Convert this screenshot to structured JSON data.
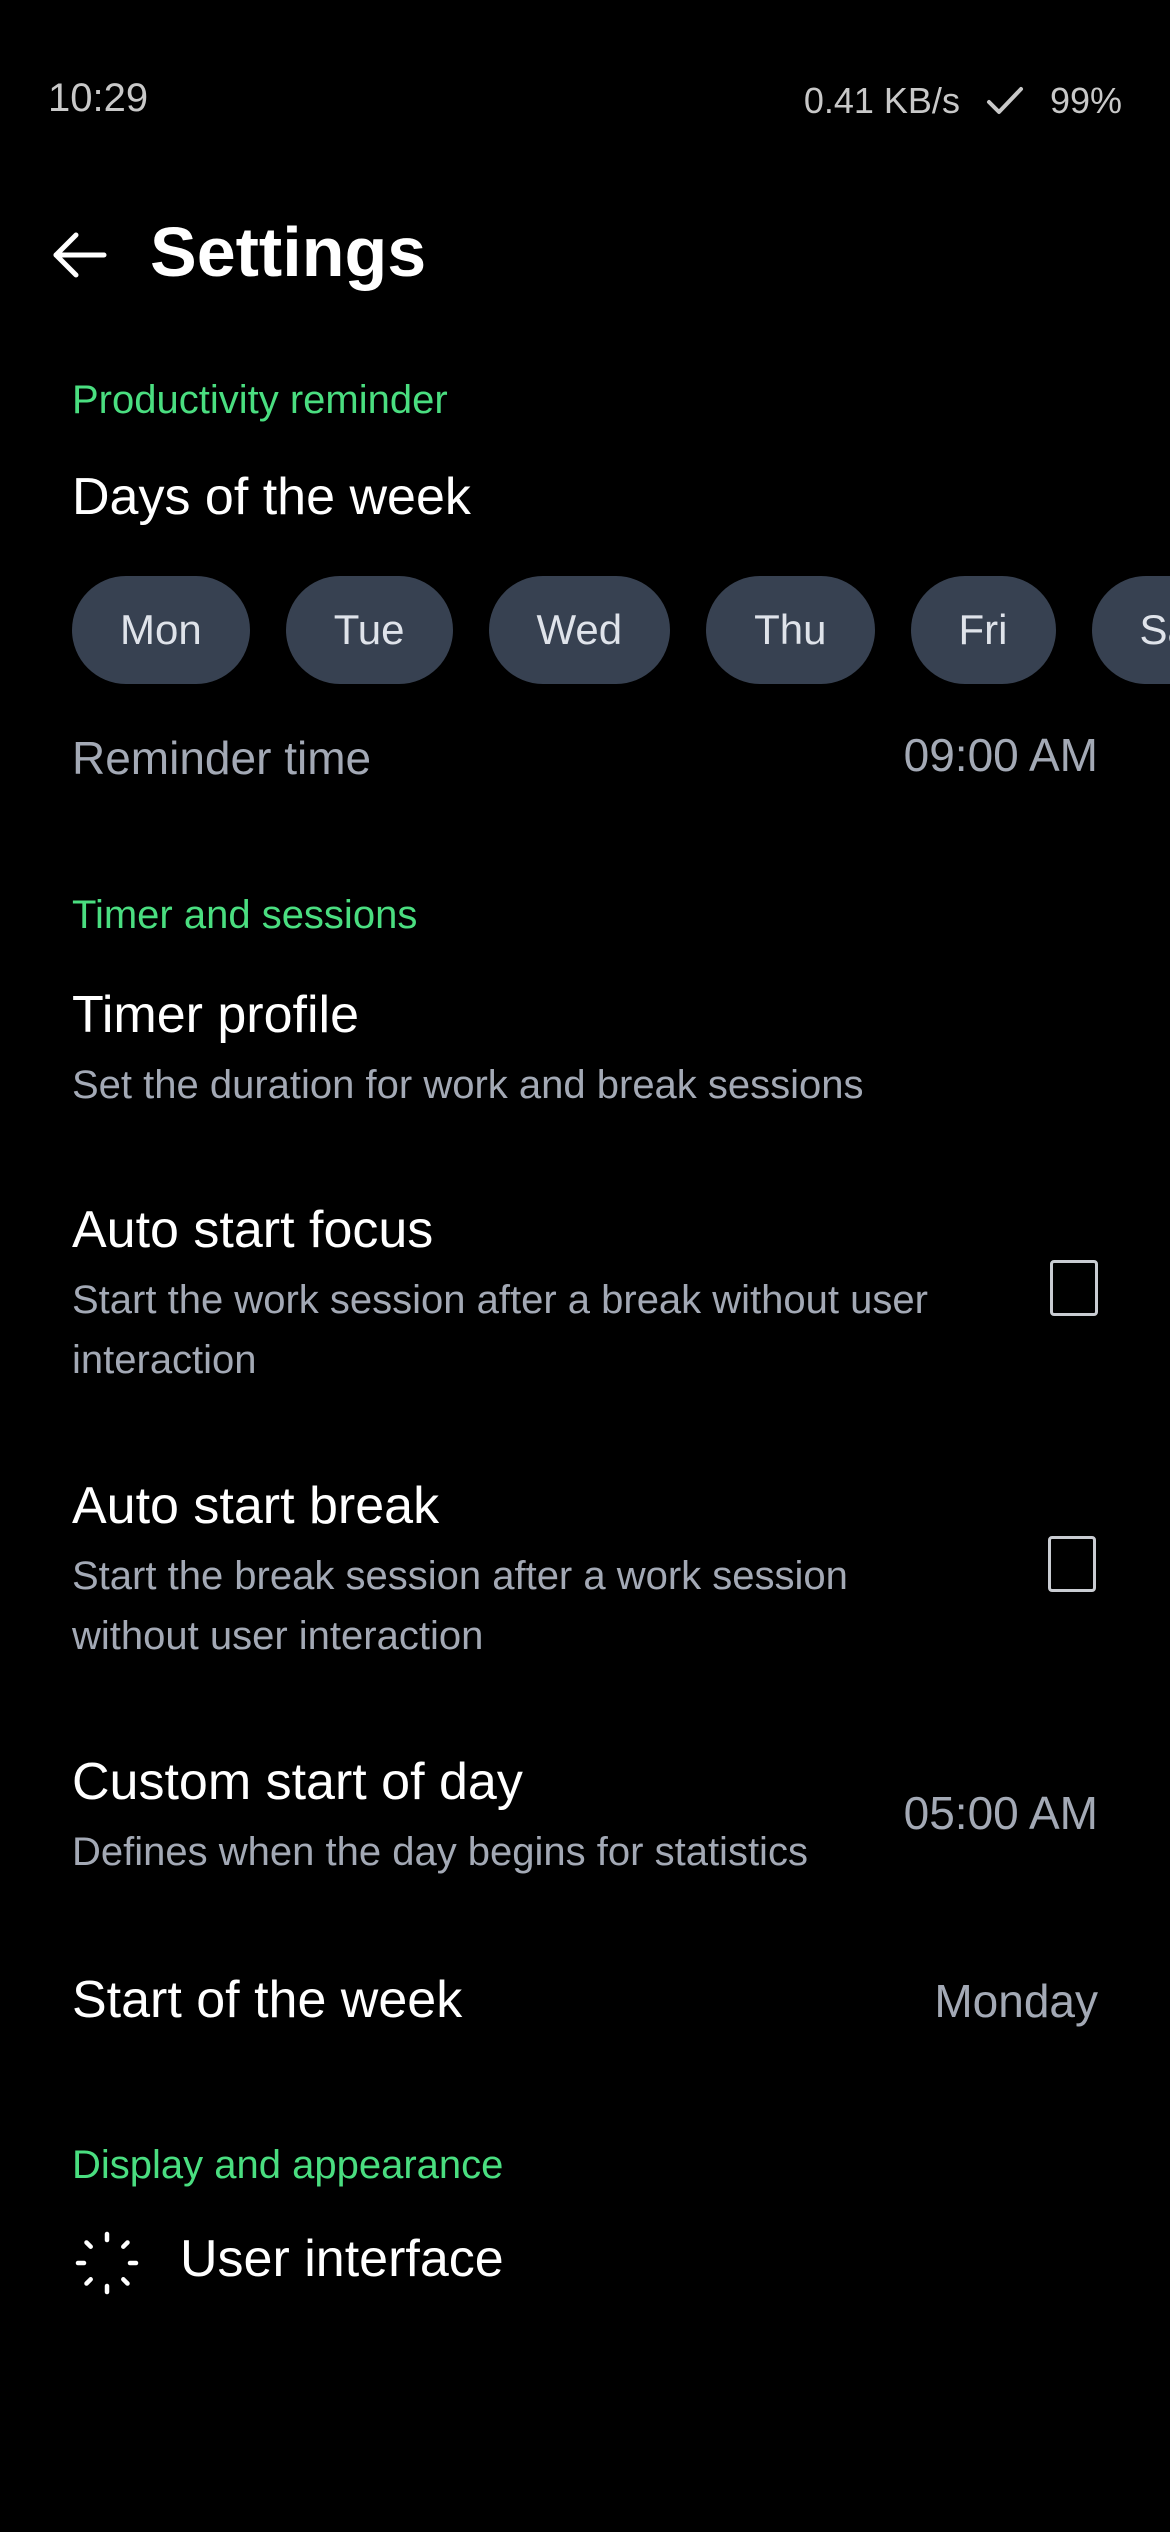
{
  "status_bar": {
    "time": "10:29",
    "network_speed": "0.41 KB/s",
    "battery": "99%",
    "icons": [
      "check-icon"
    ]
  },
  "app_bar": {
    "title": "Settings",
    "back_icon": "arrow-left-icon"
  },
  "productivity_reminder": {
    "header": "Productivity reminder",
    "days_title": "Days of the week",
    "days": [
      "Mon",
      "Tue",
      "Wed",
      "Thu",
      "Fri",
      "Sat"
    ],
    "reminder_time_label": "Reminder time",
    "reminder_time_value": "09:00 AM"
  },
  "timer_and_sessions": {
    "header": "Timer and sessions",
    "timer_profile": {
      "title": "Timer profile",
      "subtitle": "Set the duration for work and break sessions"
    },
    "auto_start_focus": {
      "title": "Auto start focus",
      "subtitle_line1": "Start the work session after a break without user",
      "subtitle_line2": "interaction",
      "checked": false
    },
    "auto_start_break": {
      "title": "Auto start break",
      "subtitle_line1": "Start the break session after a work session",
      "subtitle_line2": "without user interaction",
      "checked": false
    },
    "custom_start_of_day": {
      "title": "Custom start of day",
      "subtitle": "Defines when the day begins for statistics",
      "value": "05:00 AM"
    },
    "start_of_week": {
      "title": "Start of the week",
      "value": "Monday"
    }
  },
  "display_and_appearance": {
    "header": "Display and appearance",
    "user_interface": {
      "title": "User interface",
      "icon": "loader-dots-icon"
    }
  },
  "colors": {
    "background": "#000000",
    "accent": "#4ade80",
    "chip_background": "#374151",
    "secondary_text": "#a3a9b5"
  }
}
